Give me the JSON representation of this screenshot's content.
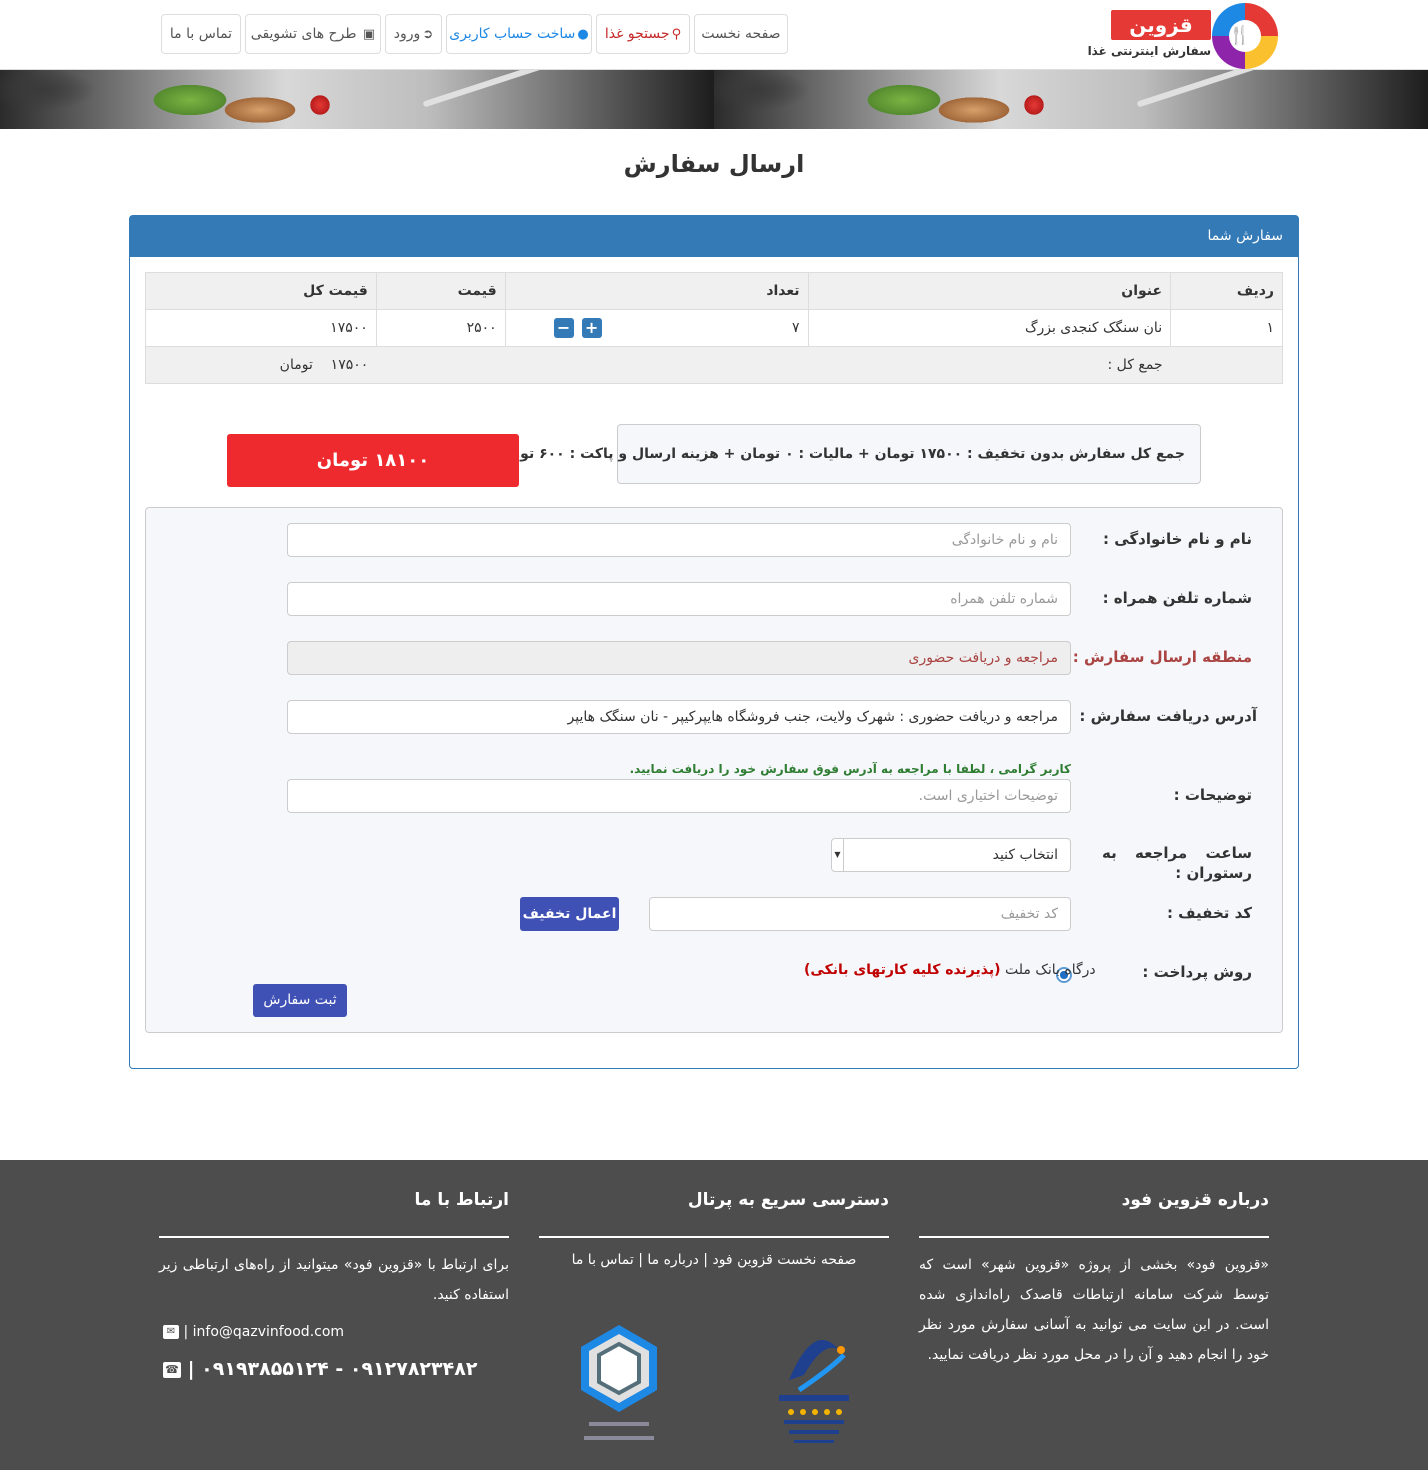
{
  "header": {
    "logo_title": "قزوین فود",
    "logo_subtitle": "سفارش اینترنتی غذا",
    "nav": {
      "home": "صفحه نخست",
      "search": "جستجو غذا",
      "register": "ساخت حساب کاربری",
      "login": "ورود",
      "promotions": "طرح های تشویقی",
      "contact": "تماس با ما"
    }
  },
  "page_title": "ارسال سفارش",
  "panel_title": "سفارش شما",
  "order_table": {
    "headers": [
      "ردیف",
      "عنوان",
      "تعداد",
      "قیمت",
      "قیمت کل"
    ],
    "rows": [
      {
        "row": "۱",
        "title": "نان سنگک کنجدی بزرگ",
        "qty": "۷",
        "price": "۲۵۰۰",
        "total": "۱۷۵۰۰"
      }
    ],
    "sum_label": "جمع کل :",
    "sum_value": "۱۷۵۰۰",
    "sum_unit": "تومان"
  },
  "summary_text": "جمع کل سفارش بدون تخفیف : ۱۷۵۰۰ تومان + مالیات : ۰ تومان + هزینه ارسال و پاکت : ۶۰۰ تومان",
  "total_button": "۱۸۱۰۰ تومان",
  "form": {
    "name_label": "نام و نام خانوادگی :",
    "name_placeholder": "نام و نام خانوادگی",
    "phone_label": "شماره تلفن همراه :",
    "phone_placeholder": "شماره تلفن همراه",
    "region_label": "منطقه ارسال سفارش :",
    "region_value": "مراجعه و دریافت حضوری",
    "address_label": "آدرس دریافت سفارش :",
    "address_value": "مراجعه و دریافت حضوری : شهرک ولایت، جنب فروشگاه هایپرکیپر - نان سنگک هایپر",
    "address_hint": "کاربر گرامی ، لطفا با مراجعه به آدرس فوق سفارش خود را دریافت نمایید.",
    "notes_label": "توضیحات :",
    "notes_placeholder": "توضیحات اختیاری است.",
    "time_label_1": "ساعت مراجعه به",
    "time_label_2": "رستوران :",
    "time_selected": "انتخاب کنید",
    "coupon_label": "کد تخفیف :",
    "coupon_placeholder": "کد تخفیف",
    "coupon_apply": "اعمال تخفیف",
    "payment_label": "روش پرداخت :",
    "payment_option": "درگاه بانک ملت",
    "payment_note": "(پذیرنده کلیه کارتهای بانکی)",
    "submit": "ثبت سفارش"
  },
  "footer": {
    "about_title": "درباره قزوین فود",
    "about_text": "«قزوین فود» بخشی از پروژه «قزوین شهر» است که توسط شرکت سامانه ارتباطات قاصدک راه‌اندازی شده است. در این سایت می توانید به آسانی سفارش مورد نظر خود را انجام دهید و آن را در محل مورد نظر دریافت نمایید.",
    "quick_title": "دسترسی سریع به پرتال",
    "quick_links": "صفحه نخست قزوین فود | درباره ما | تماس با ما",
    "contact_title": "ارتباط با ما",
    "contact_text": "برای ارتباط با «قزوین فود» میتوانید از راه‌های ارتباطی زیر استفاده کنید.",
    "email": "info@qazvinfood.com",
    "phones": "۰۹۱۹۳۸۵۵۱۲۴ - ۰۹۱۲۷۸۲۳۴۸۲"
  },
  "icons": [
    "search-icon",
    "user-icon",
    "login-icon",
    "gift-icon",
    "plus-icon",
    "minus-icon",
    "envelope-icon",
    "phone-icon",
    "enamad-badge",
    "ecunion-badge"
  ],
  "colors": {
    "primary": "#337ab7",
    "danger": "#ee2a2e",
    "indigo": "#3f51b5",
    "footer": "#4d4d4d",
    "hint": "#2e7d32"
  }
}
